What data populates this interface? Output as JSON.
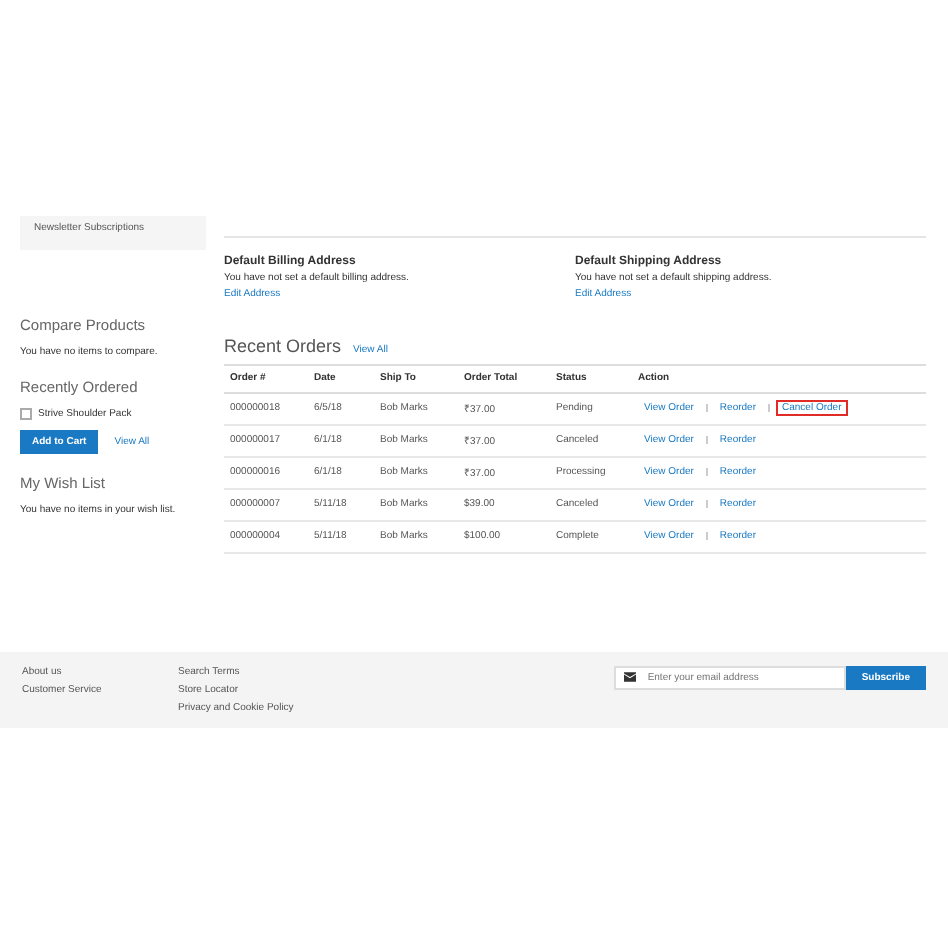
{
  "sidebar": {
    "account_nav": {
      "items": [
        {
          "label": "Newsletter Subscriptions",
          "selected": false
        }
      ]
    },
    "compare": {
      "title": "Compare Products",
      "text": "You have no items to compare."
    },
    "recently_ordered": {
      "title": "Recently Ordered",
      "items": [
        {
          "label": "Strive Shoulder Pack",
          "checked": false
        }
      ],
      "add_button": "Add to Cart",
      "view_all": "View All"
    },
    "wishlist": {
      "title": "My Wish List",
      "text": "You have no items in your wish list."
    }
  },
  "addresses": [
    {
      "title": "Default Billing Address",
      "text": "You have not set a default billing address.",
      "link": "Edit Address"
    },
    {
      "title": "Default Shipping Address",
      "text": "You have not set a default shipping address.",
      "link": "Edit Address"
    }
  ],
  "recent_orders": {
    "title": "Recent Orders",
    "view_all": "View All",
    "columns": [
      "Order #",
      "Date",
      "Ship To",
      "Order Total",
      "Status",
      "Action"
    ],
    "rows": [
      {
        "order": "000000018",
        "date": "6/5/18",
        "ship_to": "Bob Marks",
        "total": "₹37.00",
        "status": "Pending",
        "actions": [
          {
            "label": "View Order",
            "highlighted": false
          },
          {
            "label": "Reorder",
            "highlighted": false
          },
          {
            "label": "Cancel Order",
            "highlighted": true
          }
        ]
      },
      {
        "order": "000000017",
        "date": "6/1/18",
        "ship_to": "Bob Marks",
        "total": "₹37.00",
        "status": "Canceled",
        "actions": [
          {
            "label": "View Order",
            "highlighted": false
          },
          {
            "label": "Reorder",
            "highlighted": false
          }
        ]
      },
      {
        "order": "000000016",
        "date": "6/1/18",
        "ship_to": "Bob Marks",
        "total": "₹37.00",
        "status": "Processing",
        "actions": [
          {
            "label": "View Order",
            "highlighted": false
          },
          {
            "label": "Reorder",
            "highlighted": false
          }
        ]
      },
      {
        "order": "000000007",
        "date": "5/11/18",
        "ship_to": "Bob Marks",
        "total": "$39.00",
        "status": "Canceled",
        "actions": [
          {
            "label": "View Order",
            "highlighted": false
          },
          {
            "label": "Reorder",
            "highlighted": false
          }
        ]
      },
      {
        "order": "000000004",
        "date": "5/11/18",
        "ship_to": "Bob Marks",
        "total": "$100.00",
        "status": "Complete",
        "actions": [
          {
            "label": "View Order",
            "highlighted": false
          },
          {
            "label": "Reorder",
            "highlighted": false
          }
        ]
      }
    ]
  },
  "footer": {
    "link_columns": [
      [
        "About us",
        "Customer Service"
      ],
      [
        "Search Terms",
        "Store Locator",
        "Privacy and Cookie Policy"
      ]
    ],
    "newsletter": {
      "placeholder": "Enter your email address",
      "button": "Subscribe"
    }
  }
}
